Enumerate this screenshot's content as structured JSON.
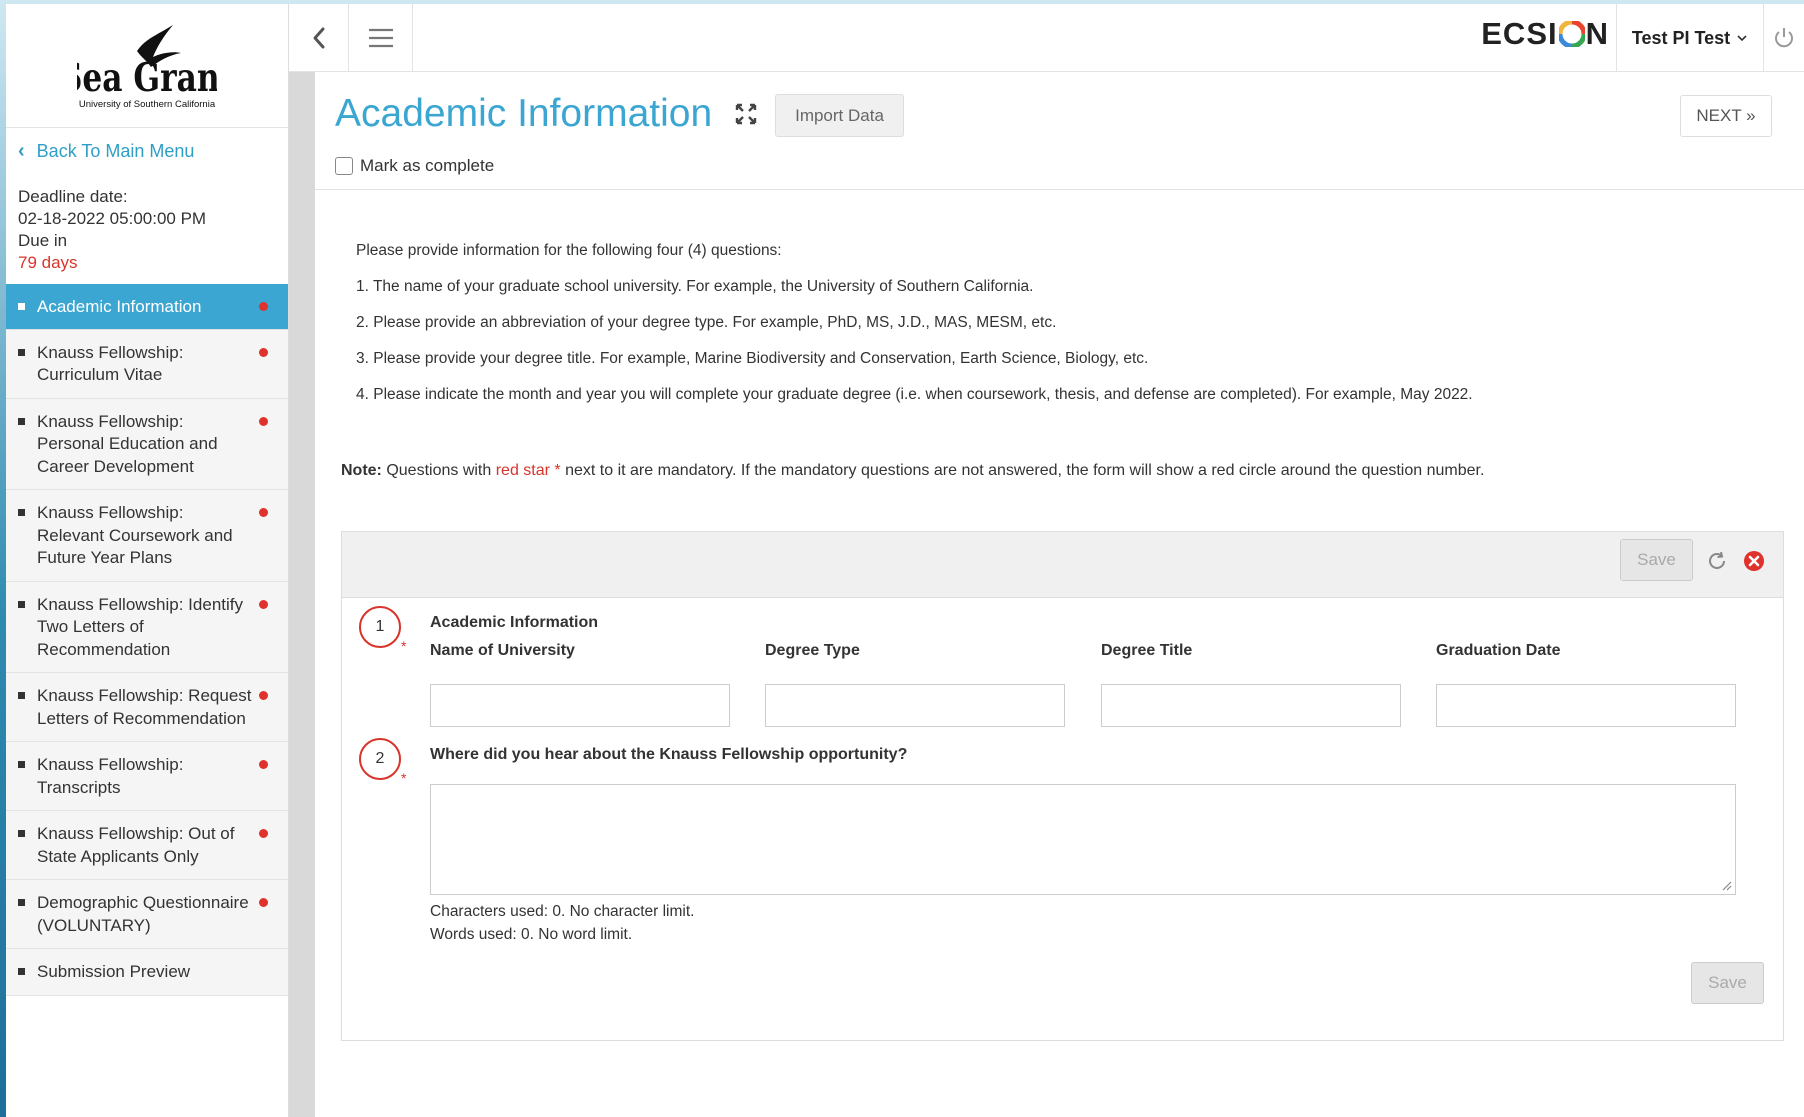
{
  "brand": {
    "logo_title": "Sea Grant",
    "logo_subtitle": "University of Southern California",
    "app_name_left": "ECSI",
    "app_name_right": "N"
  },
  "topbar": {
    "user_name": "Test PI Test"
  },
  "sidebar": {
    "back_label": "Back To Main Menu",
    "deadline_label": "Deadline date:",
    "deadline_value": "02-18-2022 05:00:00 PM",
    "due_label": "Due in",
    "due_days": "79 days",
    "items": [
      {
        "label": "Academic Information",
        "active": true,
        "incomplete": true
      },
      {
        "label": "Knauss Fellowship: Curriculum Vitae",
        "active": false,
        "incomplete": true
      },
      {
        "label": "Knauss Fellowship: Personal Education and Career Development",
        "active": false,
        "incomplete": true
      },
      {
        "label": "Knauss Fellowship: Relevant Coursework and Future Year Plans",
        "active": false,
        "incomplete": true
      },
      {
        "label": "Knauss Fellowship: Identify Two Letters of Recommendation",
        "active": false,
        "incomplete": true
      },
      {
        "label": "Knauss Fellowship: Request Letters of Recommendation",
        "active": false,
        "incomplete": true
      },
      {
        "label": "Knauss Fellowship: Transcripts",
        "active": false,
        "incomplete": true
      },
      {
        "label": "Knauss Fellowship: Out of State Applicants Only",
        "active": false,
        "incomplete": true
      },
      {
        "label": "Demographic Questionnaire (VOLUNTARY)",
        "active": false,
        "incomplete": true
      },
      {
        "label": "Submission Preview",
        "active": false,
        "incomplete": false
      }
    ]
  },
  "page": {
    "title": "Academic Information",
    "import_label": "Import Data",
    "next_label": "NEXT »",
    "mark_complete_label": "Mark as complete",
    "mark_complete_checked": false
  },
  "instructions": {
    "intro": "Please provide information for the following four (4) questions:",
    "items": [
      "1. The name of your graduate school university. For example, the University of Southern California.",
      "2. Please provide an abbreviation of your degree type. For example, PhD, MS, J.D., MAS, MESM, etc.",
      "3. Please provide your degree title. For example, Marine Biodiversity and Conservation, Earth Science, Biology, etc.",
      "4. Please indicate the month and year you will complete your graduate degree (i.e. when coursework, thesis, and defense are completed). For example, May 2022."
    ]
  },
  "note": {
    "label": "Note:",
    "before": " Questions with ",
    "red_text": "red star *",
    "after": " next to it are mandatory. If the mandatory questions are not answered, the form will show a red circle around the question number."
  },
  "form": {
    "save_label": "Save",
    "q1": {
      "number": "1",
      "title": "Academic Information",
      "fields": [
        {
          "label": "Name of University",
          "value": ""
        },
        {
          "label": "Degree Type",
          "value": ""
        },
        {
          "label": "Degree Title",
          "value": ""
        },
        {
          "label": "Graduation Date",
          "value": ""
        }
      ]
    },
    "q2": {
      "number": "2",
      "title": "Where did you hear about the Knauss Fellowship opportunity?",
      "value": "",
      "chars_used": "Characters used: 0. No character limit.",
      "words_used": "Words used: 0. No word limit."
    },
    "star": "*"
  },
  "colors": {
    "accent": "#3aa6d1",
    "required": "#d9342b"
  }
}
